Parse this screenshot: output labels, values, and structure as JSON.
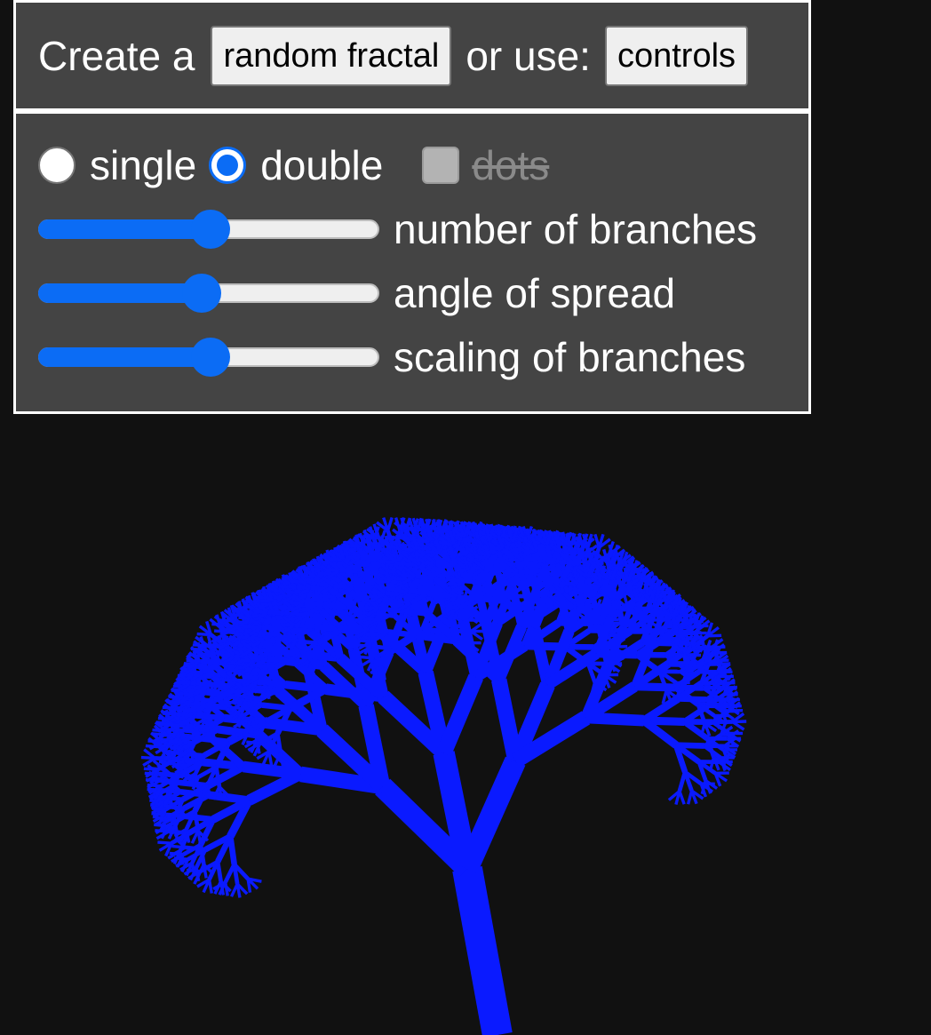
{
  "header": {
    "create_prefix": "Create a",
    "random_button": "random fractal",
    "or_use": "or use:",
    "controls_button": "controls"
  },
  "controls": {
    "modes": [
      {
        "label": "single",
        "checked": false
      },
      {
        "label": "double",
        "checked": true
      }
    ],
    "dots": {
      "label": "dots",
      "checked": false,
      "disabled": true
    },
    "sliders": [
      {
        "label": "number of branches",
        "value": 0.5
      },
      {
        "label": "angle of spread",
        "value": 0.47
      },
      {
        "label": "scaling of branches",
        "value": 0.5
      }
    ]
  },
  "fractal": {
    "color": "#0a1aff",
    "background": "#111111"
  },
  "colors": {
    "accent": "#0b6cf5",
    "panel": "#444444",
    "page": "#111111"
  }
}
